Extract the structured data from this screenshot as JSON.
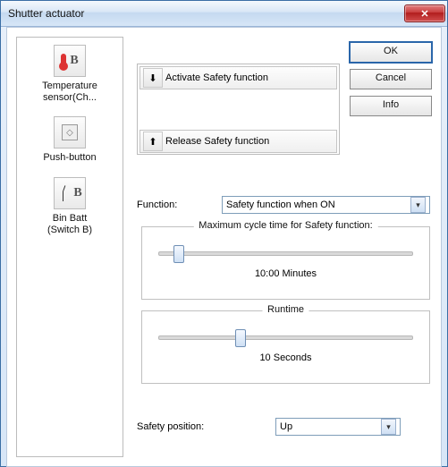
{
  "window": {
    "title": "Shutter actuator"
  },
  "buttons": {
    "ok": "OK",
    "cancel": "Cancel",
    "info": "Info"
  },
  "leftPanel": {
    "items": [
      {
        "label": "Temperature sensor(Ch...",
        "iconName": "thermometer-icon"
      },
      {
        "label": "Push-button",
        "iconName": "push-button-icon"
      },
      {
        "label": "Bin Batt\n(Switch B)",
        "iconName": "switch-icon"
      }
    ]
  },
  "functions": {
    "activate": "Activate Safety function",
    "release": "Release Safety function"
  },
  "labels": {
    "function": "Function:",
    "safetyPosition": "Safety position:"
  },
  "functionSelect": {
    "selected": "Safety function when ON"
  },
  "groups": {
    "maxCycle": {
      "legend": "Maximum cycle time for Safety function:",
      "value": "10:00 Minutes",
      "thumbPct": 6
    },
    "runtime": {
      "legend": "Runtime",
      "value": "10 Seconds",
      "thumbPct": 30
    }
  },
  "safetyPosition": {
    "selected": "Up"
  }
}
